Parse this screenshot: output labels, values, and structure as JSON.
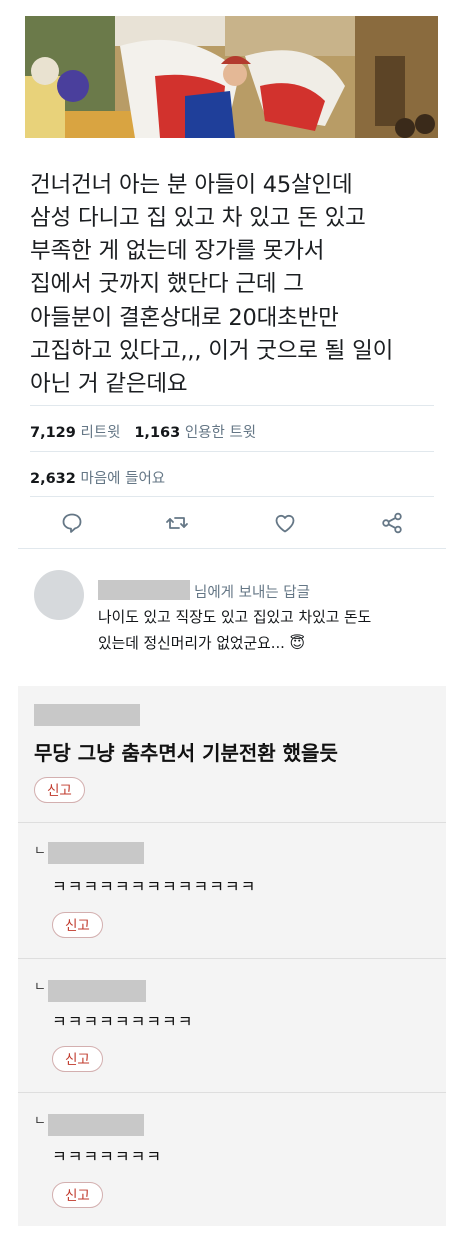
{
  "tweet": {
    "lines": [
      "건너건너 아는 분 아들이 45살인데",
      "삼성 다니고 집 있고 차 있고 돈 있고",
      "부족한 게 없는데 장가를 못가서",
      "집에서 굿까지 했단다 근데 그",
      "아들분이 결혼상대로 20대초반만",
      "고집하고 있다고,,, 이거 굿으로 될 일이",
      "아닌 거 같은데요"
    ],
    "retweet_count": "7,129",
    "retweet_label": "리트윗",
    "quote_count": "1,163",
    "quote_label": "인용한 트윗",
    "like_count": "2,632",
    "like_label": "마음에 들어요",
    "actions": [
      "reply-icon",
      "retweet-icon",
      "like-icon",
      "share-icon"
    ]
  },
  "reply": {
    "to_text": "님에게 보내는 답글",
    "lines": [
      "나이도 있고 직장도 있고 집있고 차있고 돈도",
      "있는데 정신머리가 없었군요..."
    ],
    "emoji": "😇"
  },
  "comments": {
    "main": {
      "text": "무당 그냥 춤추면서 기분전환 했을듯",
      "report_label": "신고"
    },
    "replies": [
      {
        "marker": "ㄴ",
        "text": "ㅋㅋㅋㅋㅋㅋㅋㅋㅋㅋㅋㅋㅋ",
        "report_label": "신고"
      },
      {
        "marker": "ㄴ",
        "text": "ㅋㅋㅋㅋㅋㅋㅋㅋㅋ",
        "report_label": "신고"
      },
      {
        "marker": "ㄴ",
        "text": "ㅋㅋㅋㅋㅋㅋㅋ",
        "report_label": "신고"
      }
    ]
  },
  "colors": {
    "text": "#14171a",
    "muted": "#657786",
    "divider": "#e1e8ed",
    "report_red": "#c0392b",
    "comment_bg": "#f4f4f4"
  }
}
